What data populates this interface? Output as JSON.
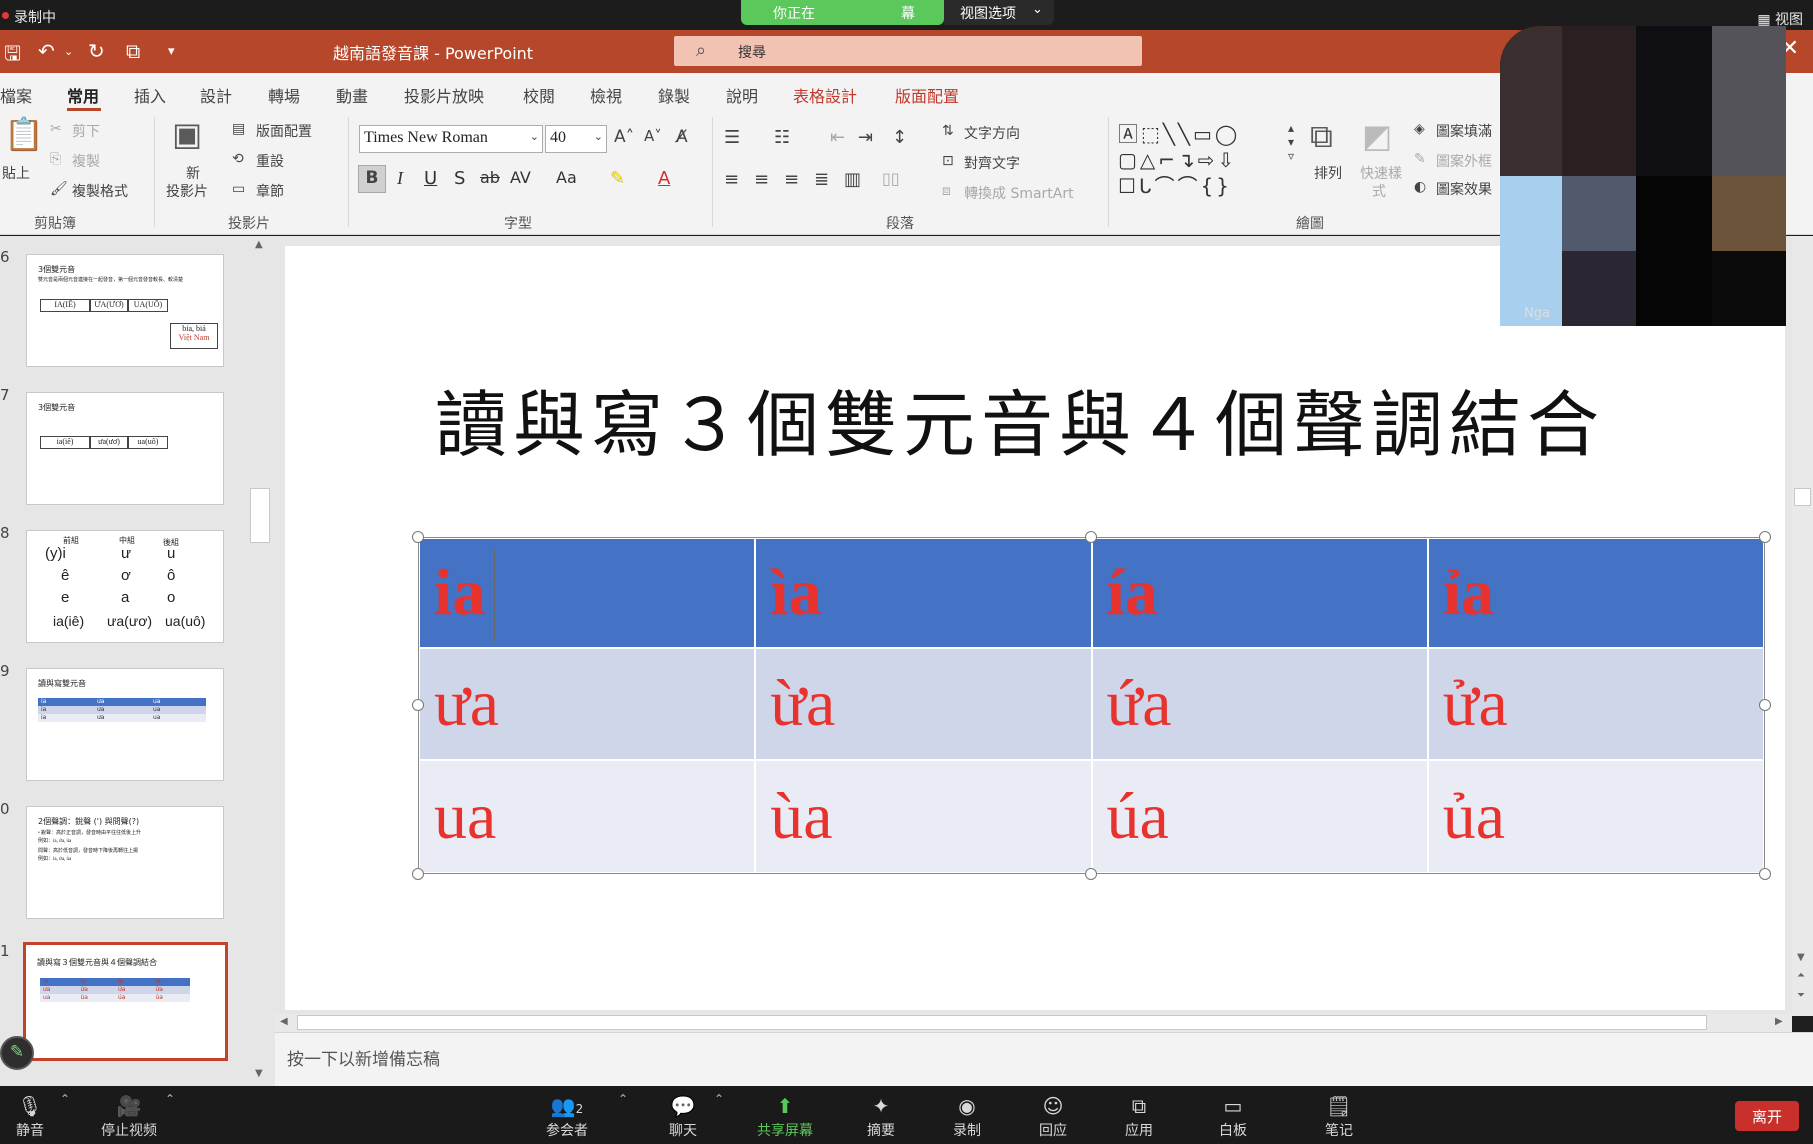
{
  "zoom_top": {
    "recording_label": "录制中",
    "share_text_left": "你正在",
    "share_text_right": "幕",
    "view_options": "视图选项",
    "view_right": "视图"
  },
  "window": {
    "title": "越南語發音課  -  PowerPoint",
    "search_placeholder": "搜尋"
  },
  "ribbon_tabs": [
    "檔案",
    "常用",
    "插入",
    "設計",
    "轉場",
    "動畫",
    "投影片放映",
    "校閱",
    "檢視",
    "錄製",
    "說明",
    "表格設計",
    "版面配置"
  ],
  "ribbon": {
    "clipboard": {
      "paste": "貼上",
      "cut": "剪下",
      "copy": "複製",
      "format_painter": "複製格式",
      "group": "剪貼簿"
    },
    "slides": {
      "new_slide_1": "新",
      "new_slide_2": "投影片",
      "layout": "版面配置",
      "reset": "重設",
      "section": "章節",
      "group": "投影片"
    },
    "font": {
      "name": "Times New Roman",
      "size": "40",
      "group": "字型",
      "bold": "B",
      "italic": "I",
      "underline": "U",
      "shadow": "S",
      "strike": "ab",
      "spacing": "AV",
      "case": "Aa",
      "color": "A"
    },
    "paragraph": {
      "text_direction": "文字方向",
      "align_text": "對齊文字",
      "smartart": "轉換成 SmartArt",
      "group": "段落"
    },
    "drawing": {
      "arrange": "排列",
      "quick_styles_1": "快速樣",
      "quick_styles_2": "式",
      "shape_fill": "圖案填滿",
      "shape_outline": "圖案外框",
      "shape_effects": "圖案效果",
      "group": "繪圖"
    }
  },
  "thumbnails": {
    "numbers": [
      "6",
      "7",
      "8",
      "9",
      "0",
      "1"
    ],
    "t6": {
      "title": "3個雙元音",
      "subtitle": "雙元音是兩個元音連接在一起發音，第一個元音發音較長、較清楚",
      "boxes": [
        "IA(IÊ)",
        "ƯA(ƯƠ)",
        "UA(UÔ)"
      ],
      "word1": "bia, biả",
      "word2": "Việt Nam"
    },
    "t7": {
      "title": "3個雙元音",
      "boxes": [
        "ia(iê)",
        "ưa(ươ)",
        "ua(uô)"
      ]
    },
    "t8": {
      "heads": [
        "前組",
        "中組",
        "後組"
      ],
      "rows": [
        [
          "(y)i",
          "ư",
          "u"
        ],
        [
          "ê",
          "ơ",
          "ô"
        ],
        [
          "e",
          "a",
          "o"
        ],
        [
          "ia(iê)",
          "ưa(ươ)",
          "ua(uô)"
        ]
      ]
    },
    "t9": {
      "title": "讀與寫雙元音",
      "rows": [
        [
          "ia",
          "ưa",
          "ua"
        ],
        [
          "ia",
          "ưa",
          "ua"
        ],
        [
          "ia",
          "ưa",
          "ua"
        ]
      ]
    },
    "t10": {
      "title": "2個聲調：銳聲 (') 與問聲(?)",
      "line1": "• 銳聲：高於正音調，發音時由平往往低後上升",
      "line2": "  例如：ía, ứa, úa",
      "line3": "  問聲：高於低音調，發音時下降後再轉往上揚",
      "line4": "  例如：ỉa, ửa, ủa"
    },
    "t11": {
      "title": "讀與寫３個雙元音與４個聲調結合",
      "rows": [
        [
          "ia",
          "ìa",
          "ía",
          "ỉa"
        ],
        [
          "ưa",
          "ừa",
          "ứa",
          "ửa"
        ],
        [
          "ua",
          "ùa",
          "úa",
          "ủa"
        ]
      ]
    }
  },
  "slide": {
    "title": "讀與寫３個雙元音與４個聲調結合",
    "table": [
      [
        "ia",
        "ìa",
        "ía",
        "ỉa"
      ],
      [
        "ưa",
        "ừa",
        "ứa",
        "ửa"
      ],
      [
        "ua",
        "ùa",
        "úa",
        "ủa"
      ]
    ]
  },
  "notes_placeholder": "按一下以新增備忘稿",
  "webcam_name": "Nga",
  "zoom_bottom": {
    "mute": "静音",
    "stop_video": "停止视频",
    "participants": "参会者",
    "participants_count": "2",
    "chat": "聊天",
    "share_screen": "共享屏幕",
    "summary": "摘要",
    "record": "录制",
    "reactions": "回应",
    "apps": "应用",
    "whiteboard": "白板",
    "notes": "笔记",
    "leave": "离开"
  },
  "colors": {
    "ppt_brand": "#b7472a",
    "table_header": "#4472c4",
    "table_text": "#e8322d",
    "zoom_share_green": "#5bc85b",
    "leave_red": "#c9302c"
  }
}
